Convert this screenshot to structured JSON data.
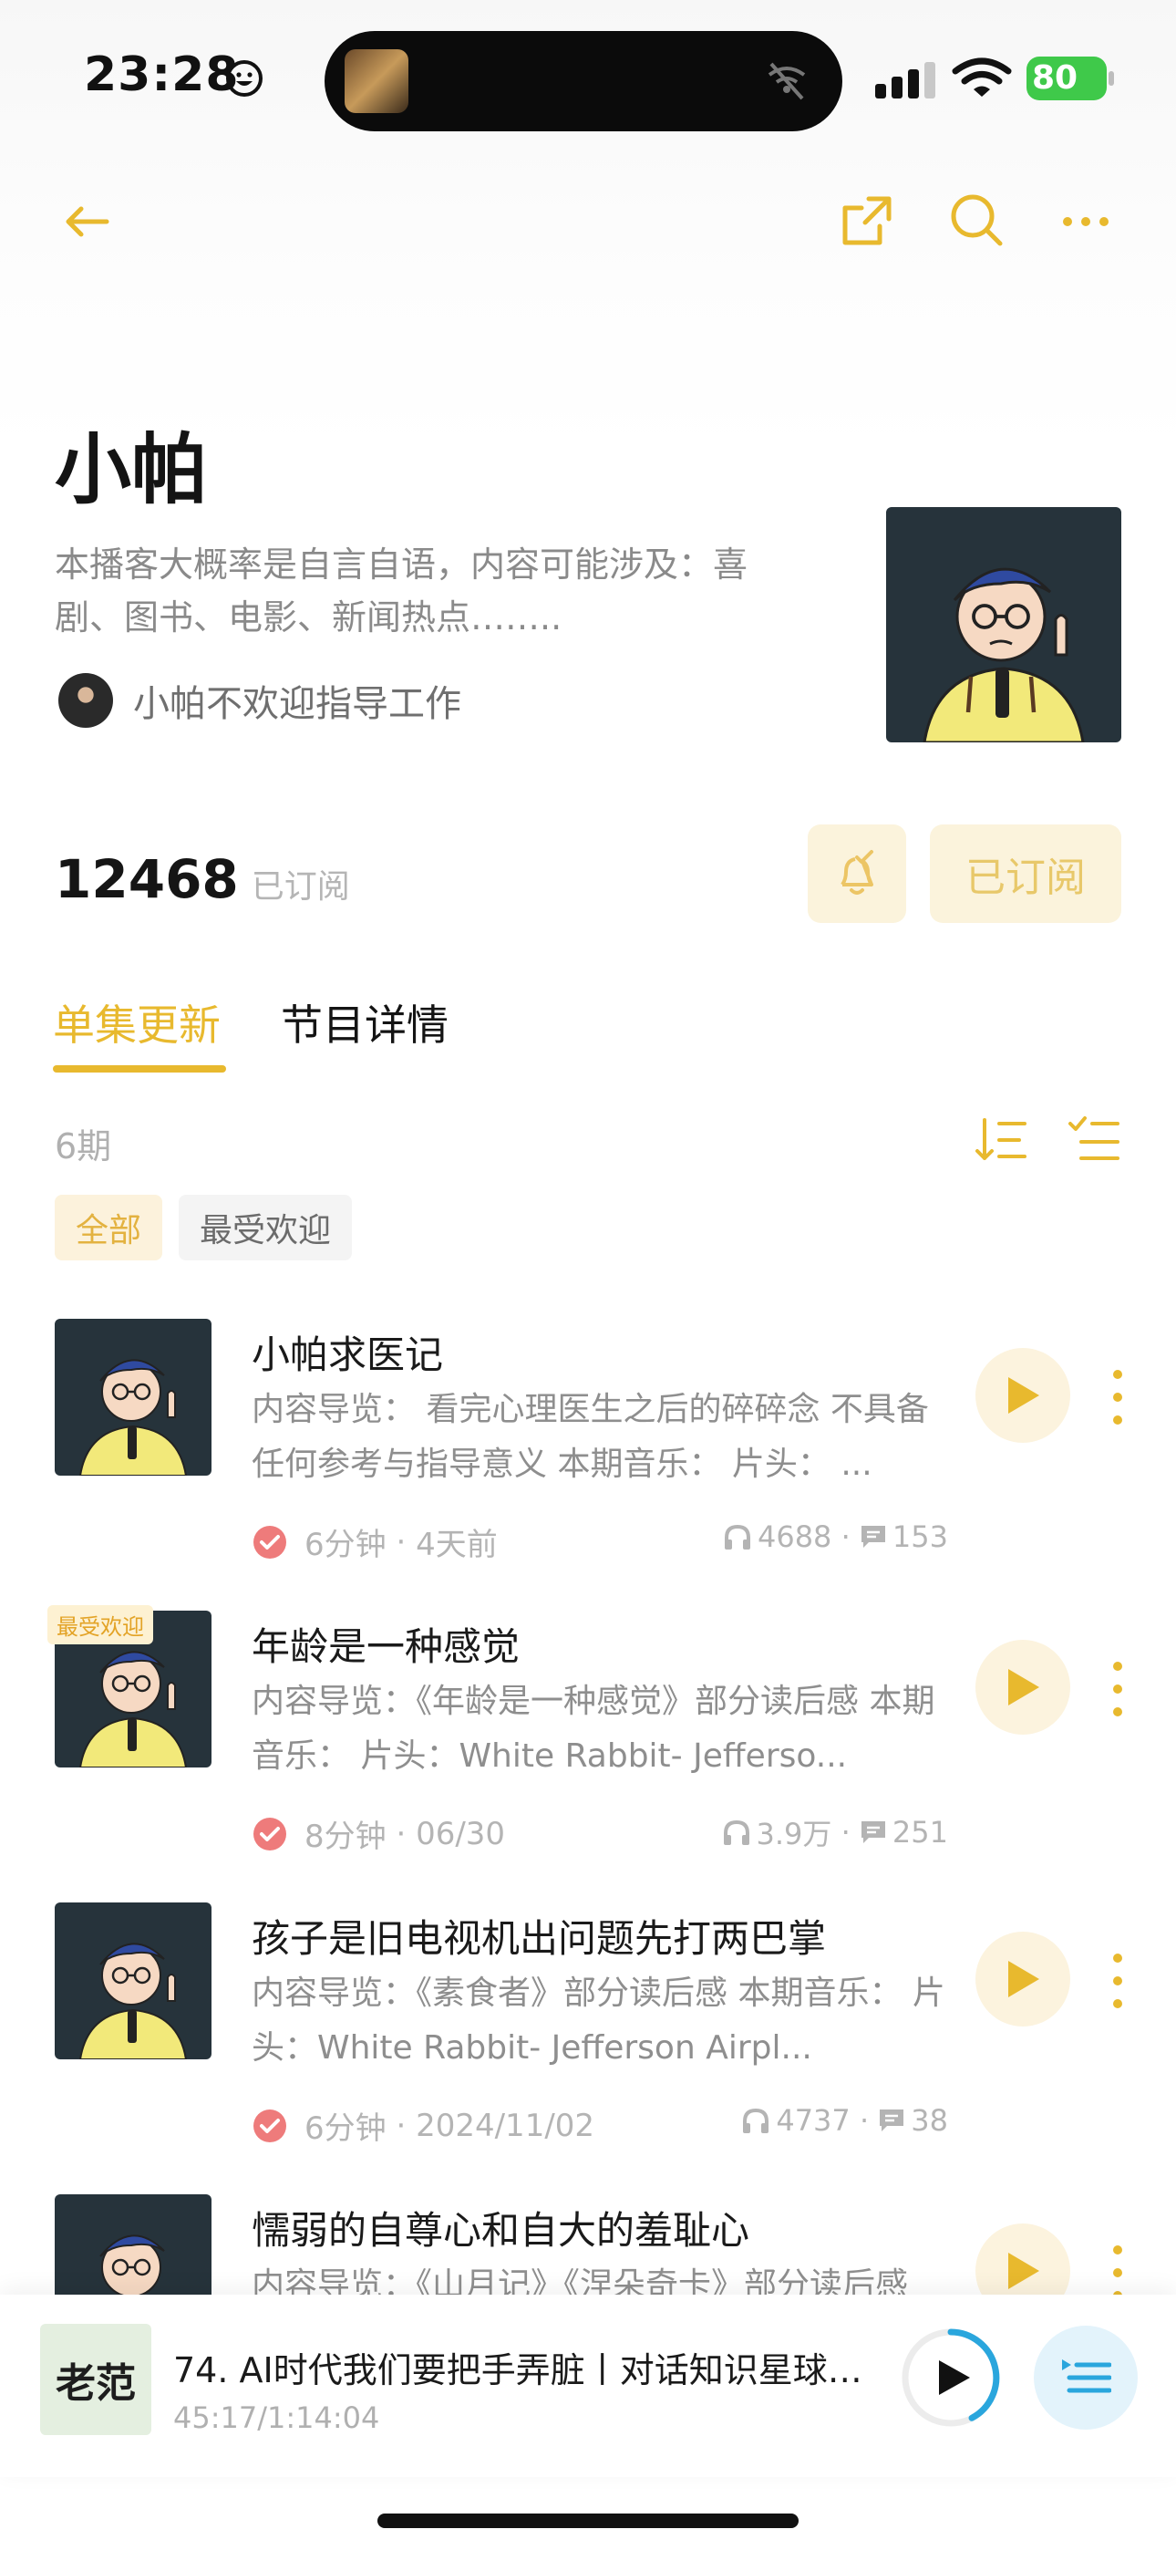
{
  "status_bar": {
    "time": "23:28",
    "battery": "80"
  },
  "podcast": {
    "title": "小帕",
    "description": "本播客大概率是自言自语，内容可能涉及：喜剧、图书、电影、新闻热点……..",
    "author": "小帕不欢迎指导工作",
    "subscribers": "12468",
    "subscribers_label": "已订阅",
    "subscribed_button": "已订阅"
  },
  "tabs": [
    {
      "label": "单集更新"
    },
    {
      "label": "节目详情"
    }
  ],
  "episode_count": "6期",
  "filters": [
    {
      "label": "全部"
    },
    {
      "label": "最受欢迎"
    }
  ],
  "episodes": [
    {
      "title": "小帕求医记",
      "badge": "",
      "description": "内容导览： 看完心理医生之后的碎碎念 不具备任何参考与指导意义 本期音乐： 片头： ...",
      "duration": "6分钟",
      "date": "4天前",
      "plays": "4688",
      "comments": "153"
    },
    {
      "title": "年龄是一种感觉",
      "badge": "最受欢迎",
      "description": "内容导览：《年龄是一种感觉》部分读后感 本期音乐： 片头：White Rabbit- Jefferso...",
      "duration": "8分钟",
      "date": "06/30",
      "plays": "3.9万",
      "comments": "251"
    },
    {
      "title": "孩子是旧电视机出问题先打两巴掌",
      "badge": "",
      "description": "内容导览：《素食者》部分读后感 本期音乐： 片头：White Rabbit- Jefferson Airpl...",
      "duration": "6分钟",
      "date": "2024/11/02",
      "plays": "4737",
      "comments": "38"
    },
    {
      "title": "懦弱的自尊心和自大的羞耻心",
      "badge": "",
      "description": "内容导览：《山月记》《涅朵奇卡》部分读后感",
      "duration": "",
      "date": "",
      "plays": "",
      "comments": ""
    }
  ],
  "mini_player": {
    "cover_text": "老范",
    "title": "74. AI时代我们要把手弄脏丨对话知识星球…",
    "progress": "45:17/1:14:04"
  },
  "colors": {
    "accent": "#e8b92e",
    "accent_bg": "#fcf3de",
    "played": "#ee7b7b",
    "player_ring": "#2aa6dd"
  }
}
